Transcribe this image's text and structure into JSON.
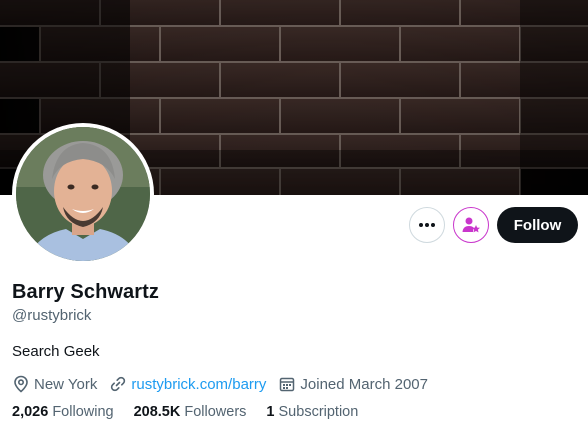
{
  "profile": {
    "name": "Barry Schwartz",
    "handle": "@rustybrick",
    "bio": "Search Geek",
    "location": "New York",
    "website": "rustybrick.com/barry",
    "joined": "Joined March 2007"
  },
  "actions": {
    "more_icon": "more-horizontal-icon",
    "subscribe_icon": "subscribe-person-star-icon",
    "follow_label": "Follow"
  },
  "stats": {
    "following_count": "2,026",
    "following_label": "Following",
    "followers_count": "208.5K",
    "followers_label": "Followers",
    "subscriptions_count": "1",
    "subscriptions_label": "Subscription"
  },
  "colors": {
    "accent": "#1d9bf0",
    "subscribe": "#c936cc",
    "follow_bg": "#0f1419",
    "secondary_text": "#536471"
  }
}
